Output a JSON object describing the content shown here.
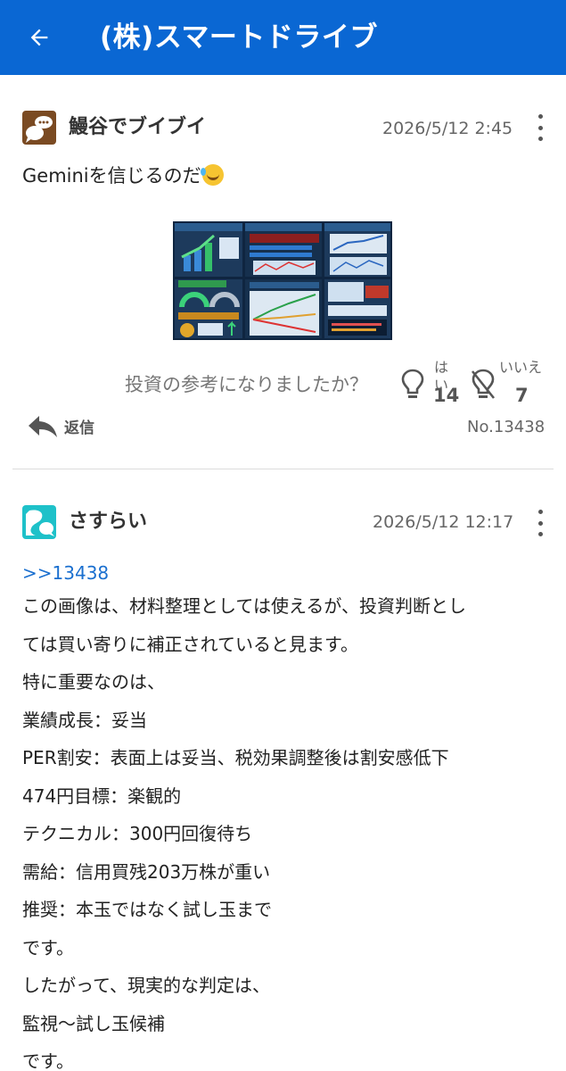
{
  "header": {
    "title": "(株)スマートドライブ",
    "back_icon": "arrow-left-icon",
    "bg_color": "#0a67d3"
  },
  "posts": [
    {
      "user": "鰻谷でブイブイ",
      "time": "2026/5/12 2:45",
      "body": "Geminiを信じるのだ",
      "emoji": "rolling-on-floor-laughing-emoji",
      "has_image": true,
      "feedback": {
        "question": "投資の参考になりましたか？",
        "yes_label": "はい",
        "yes_count": "14",
        "no_label": "いいえ",
        "no_count": "7"
      },
      "reply_label": "返信",
      "number": "No.13438"
    },
    {
      "user": "さすらい",
      "time": "2026/5/12 12:17",
      "anchor": ">>13438",
      "lines": [
        "この画像は、材料整理としては使えるが、投資判断とし",
        "ては買い寄りに補正されていると見ます。",
        "特に重要なのは、",
        "業績成長：妥当",
        "PER割安：表面上は妥当、税効果調整後は割安感低下",
        "474円目標：楽観的",
        "テクニカル：300円回復待ち",
        "需給：信用買残203万株が重い",
        "推奨：本玉ではなく試し玉まで",
        "です。",
        "したがって、現実的な判定は、",
        "監視〜試し玉候補",
        "です。"
      ]
    }
  ]
}
